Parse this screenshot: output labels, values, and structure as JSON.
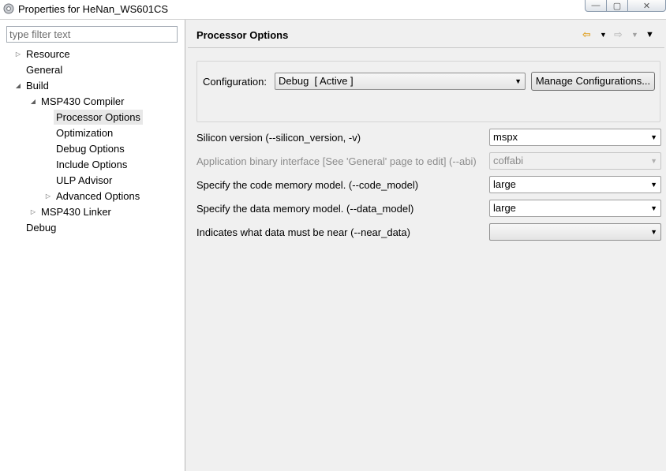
{
  "window": {
    "title": "Properties for HeNan_WS601CS",
    "icon": "properties-gear-icon",
    "controls": {
      "minimize": "minimize-icon",
      "maximize": "maximize-icon",
      "close": "close-icon"
    }
  },
  "filter": {
    "placeholder": "type filter text",
    "value": ""
  },
  "tree": [
    {
      "label": "Resource",
      "expander": "▷"
    },
    {
      "label": "General",
      "expander": ""
    },
    {
      "label": "Build",
      "expander": "◢"
    },
    {
      "label": "MSP430 Compiler",
      "expander": "◢"
    },
    {
      "label": "Processor Options",
      "expander": "",
      "selected": true
    },
    {
      "label": "Optimization",
      "expander": ""
    },
    {
      "label": "Debug Options",
      "expander": ""
    },
    {
      "label": "Include Options",
      "expander": ""
    },
    {
      "label": "ULP Advisor",
      "expander": ""
    },
    {
      "label": "Advanced Options",
      "expander": "▷"
    },
    {
      "label": "MSP430 Linker",
      "expander": "▷"
    },
    {
      "label": "Debug",
      "expander": ""
    }
  ],
  "page": {
    "title": "Processor Options",
    "nav": {
      "back": "back-arrow-icon",
      "forward": "forward-arrow-icon",
      "menu": "view-menu-icon"
    },
    "configuration": {
      "label": "Configuration:",
      "value": "Debug  [ Active ]",
      "manage_button": "Manage Configurations..."
    },
    "options": [
      {
        "label": "Silicon version (--silicon_version, -v)",
        "value": "mspx",
        "enabled": true
      },
      {
        "label": "Application binary interface [See 'General' page to edit] (--abi)",
        "value": "coffabi",
        "enabled": false
      },
      {
        "label": "Specify the code memory model. (--code_model)",
        "value": "large",
        "enabled": true
      },
      {
        "label": "Specify the data memory model. (--data_model)",
        "value": "large",
        "enabled": true
      },
      {
        "label": "Indicates what data must be near (--near_data)",
        "value": "",
        "enabled": true
      }
    ]
  },
  "colors": {
    "nav_back_arrow": "#e0a020",
    "selection_bg": "#e8e8e8",
    "disabled_text": "#8c8c8c"
  }
}
